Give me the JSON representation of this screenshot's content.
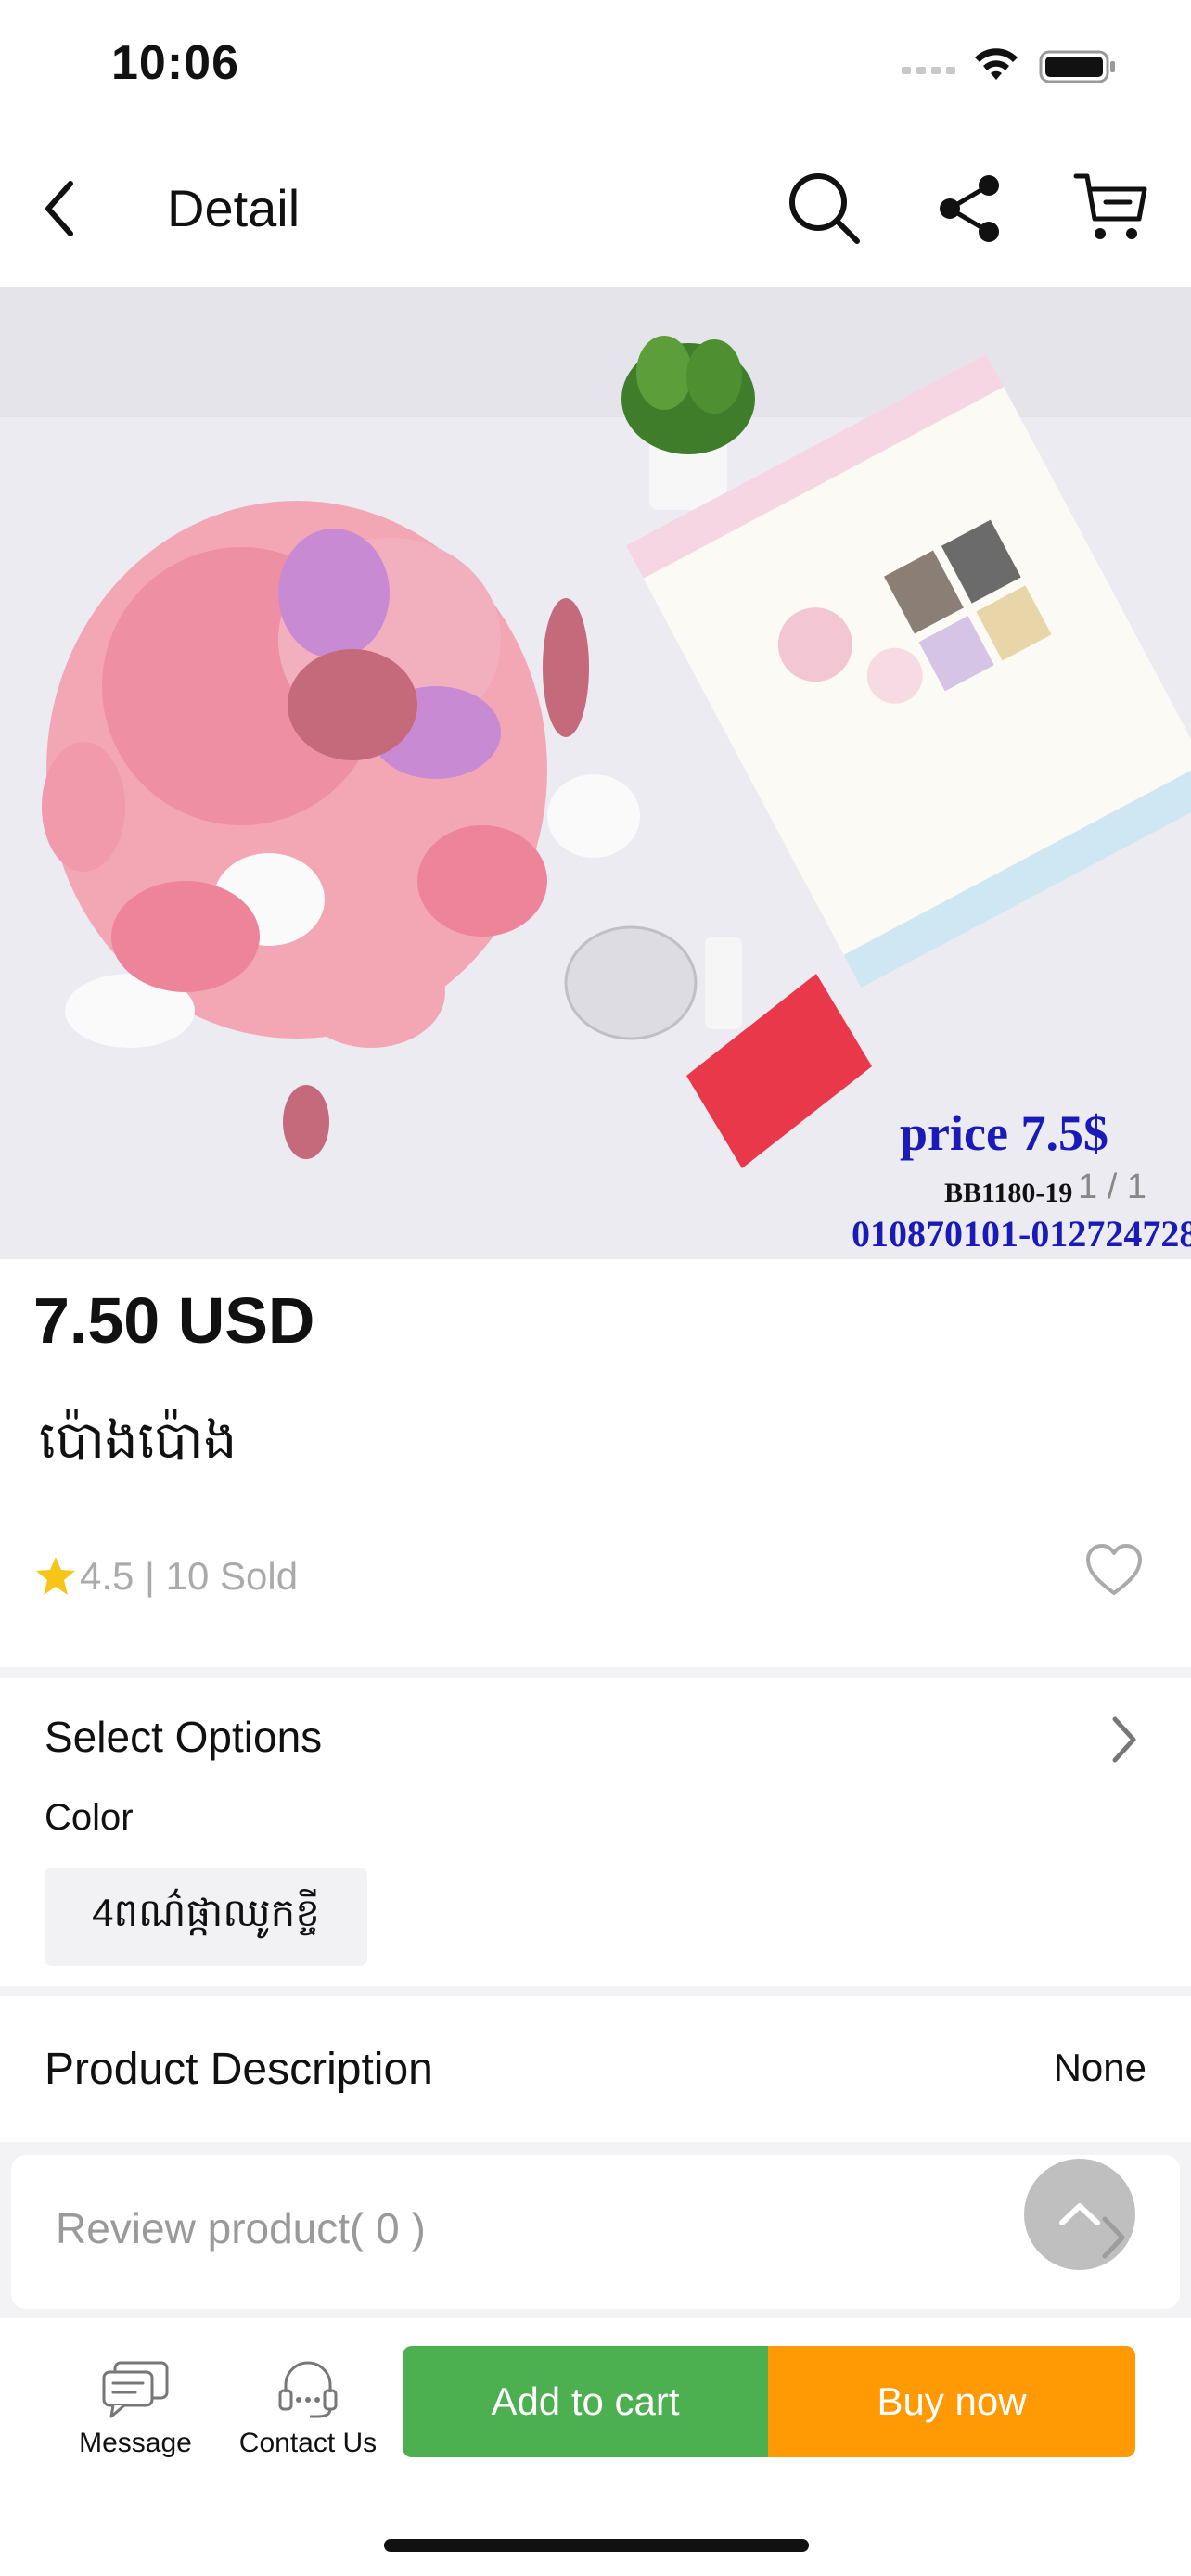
{
  "status_bar": {
    "time": "10:06"
  },
  "nav": {
    "title": "Detail",
    "icons": [
      "back-icon",
      "search-icon",
      "share-icon",
      "cart-icon"
    ]
  },
  "product_image": {
    "overlay_price": "price 7.5$",
    "overlay_code": "BB1180-19",
    "overlay_phones": "010870101-012724728",
    "counter": "1 / 1"
  },
  "product": {
    "price": "7.50 USD",
    "name": "ប៉ោងប៉ោង",
    "rating_text": "4.5 | 10 Sold",
    "rating": 4.5,
    "sold": 10
  },
  "options": {
    "title": "Select Options",
    "color_label": "Color",
    "selected_color": "4ពណ៌ផ្កាឈូកខ្ចី"
  },
  "description": {
    "title": "Product Description",
    "value": "None"
  },
  "review": {
    "label": "Review product( 0 )"
  },
  "bottom_bar": {
    "message_label": "Message",
    "contact_label": "Contact Us",
    "add_to_cart_label": "Add to cart",
    "buy_now_label": "Buy now"
  },
  "colors": {
    "add_to_cart": "#4caf50",
    "buy_now": "#ff9a05",
    "star": "#f5c518",
    "muted_text": "#aaaaaa"
  }
}
